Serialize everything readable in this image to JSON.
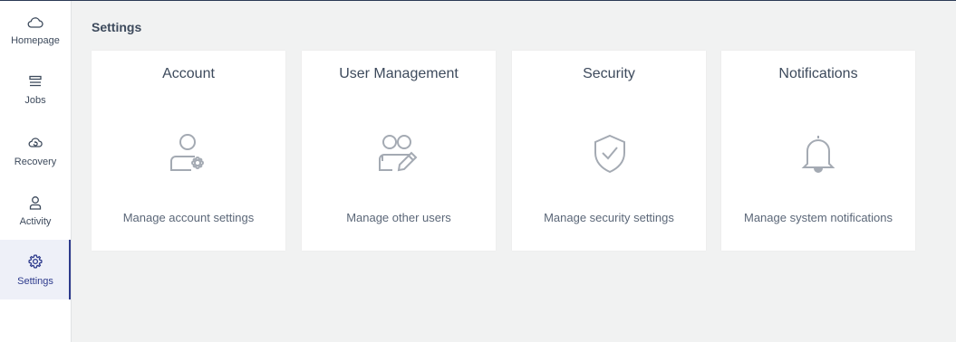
{
  "sidebar": {
    "items": [
      {
        "label": "Homepage",
        "icon": "cloud-icon",
        "active": false
      },
      {
        "label": "Jobs",
        "icon": "jobs-icon",
        "active": false
      },
      {
        "label": "Recovery",
        "icon": "recovery-icon",
        "active": false
      },
      {
        "label": "Activity",
        "icon": "activity-icon",
        "active": false
      },
      {
        "label": "Settings",
        "icon": "gear-icon",
        "active": true
      }
    ]
  },
  "page": {
    "title": "Settings"
  },
  "cards": [
    {
      "title": "Account",
      "description": "Manage account settings",
      "icon": "user-gear-icon"
    },
    {
      "title": "User Management",
      "description": "Manage other users",
      "icon": "users-edit-icon"
    },
    {
      "title": "Security",
      "description": "Manage security settings",
      "icon": "shield-check-icon"
    },
    {
      "title": "Notifications",
      "description": "Manage system notifications",
      "icon": "bell-icon"
    }
  ],
  "colors": {
    "accent": "#2d3a8c",
    "text": "#3d4a5c",
    "icon_gray": "#a4aab3",
    "background": "#f1f2f2"
  }
}
